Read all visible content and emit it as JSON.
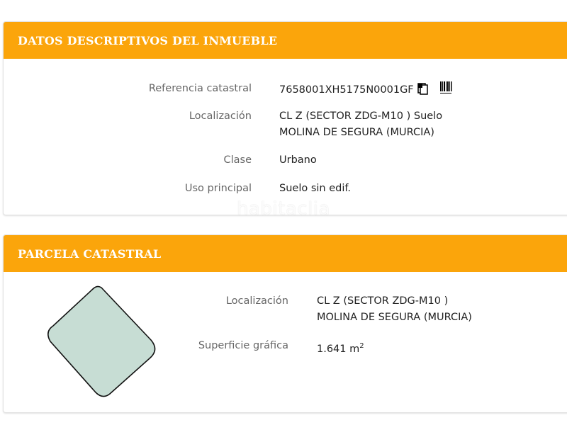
{
  "section1": {
    "title": "DATOS DESCRIPTIVOS DEL INMUEBLE",
    "rows": [
      {
        "label": "Referencia catastral",
        "value": "7658001XH5175N0001GF"
      },
      {
        "label": "Localización",
        "value_line1": "CL Z (SECTOR ZDG-M10 ) Suelo",
        "value_line2": "MOLINA DE SEGURA (MURCIA)"
      },
      {
        "label": "Clase",
        "value": "Urbano"
      },
      {
        "label": "Uso principal",
        "value": "Suelo sin edif."
      }
    ],
    "icons": [
      "copy-document-icon",
      "barcode-icon"
    ]
  },
  "section2": {
    "title": "PARCELA CATASTRAL",
    "rows": [
      {
        "label": "Localización",
        "value_line1": "CL Z (SECTOR ZDG-M10 )",
        "value_line2": "MOLINA DE SEGURA (MURCIA)"
      },
      {
        "label": "Superficie gráfica",
        "value": "1.641 m",
        "unit_sup": "2"
      }
    ],
    "parcel_fill": "#c7ddd4"
  },
  "watermark": "habitaclia",
  "colors": {
    "header": "#fba50b",
    "label": "#666666",
    "value": "#222222"
  }
}
